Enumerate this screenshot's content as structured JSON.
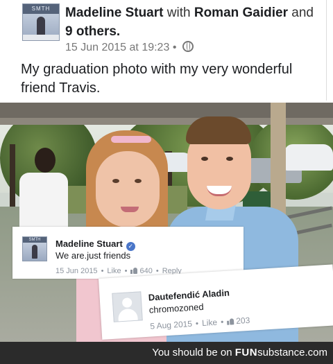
{
  "post": {
    "author": "Madeline Stuart",
    "with_word": "with",
    "tagged": "Roman Gaidier",
    "and_word": "and",
    "others": "9 others.",
    "timestamp": "15 Jun 2015 at 19:23",
    "dot": "•",
    "privacy_icon": "globe-icon",
    "text": "My graduation photo with my very wonderful friend Travis.",
    "avatar_tag": "SMTH"
  },
  "comment1": {
    "name": "Madeline Stuart",
    "verified_icon": "verified-icon",
    "text": "We are.just friends",
    "date": "15 Jun 2015",
    "like_label": "Like",
    "reaction_count": "640",
    "reply_label": "Reply",
    "dot": "•",
    "avatar_tag": "SMTH"
  },
  "comment2": {
    "name": "Dautefendić Aladin",
    "text": "chromozoned",
    "date": "5 Aug 2015",
    "like_label": "Like",
    "reaction_count": "203",
    "dot": "•"
  },
  "footer": {
    "prefix": "You should be on ",
    "brand_bold": "FUN",
    "brand_rest": "substance",
    "suffix": ".com"
  },
  "colors": {
    "footer_bg": "#2b2b2b",
    "verified": "#4a76c9",
    "meta_text": "#8d949e"
  }
}
